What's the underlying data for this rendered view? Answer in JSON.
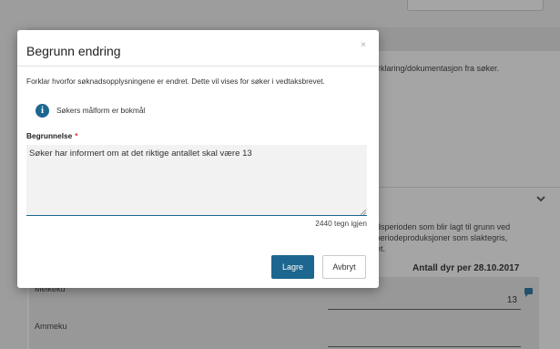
{
  "background": {
    "card_text": "orklaring/dokumentasjon fra søker.",
    "section_text_lines": [
      "adsperioden som blir lagt til grunn ved",
      "i periodeproduksjoner som slaktegris,",
      "det."
    ],
    "table_header": "Antall dyr per 28.10.2017",
    "rows": [
      {
        "label": "Melkeku",
        "value": "13"
      },
      {
        "label": "Ammeku",
        "value": ""
      }
    ]
  },
  "modal": {
    "title": "Begrunn endring",
    "close_symbol": "×",
    "description": "Forklar hvorfor søknadsopplysningene er endret. Dette vil vises for søker i vedtaksbrevet.",
    "info_icon_glyph": "i",
    "info_text": "Søkers målform er bokmål",
    "field_label": "Begrunnelse",
    "required_marker": "*",
    "textarea_value": "Søker har informert om at det riktige antallet skal være 13",
    "char_count": "2440 tegn igjen",
    "save_label": "Lagre",
    "cancel_label": "Avbryt"
  },
  "icons": {
    "info": "info-circle-icon",
    "close": "close-icon",
    "chevron": "chevron-down-icon",
    "comment": "comment-icon"
  },
  "colors": {
    "primary": "#1d6690",
    "required": "#d9312b",
    "overlay": "rgba(40,40,40,0.42)"
  }
}
